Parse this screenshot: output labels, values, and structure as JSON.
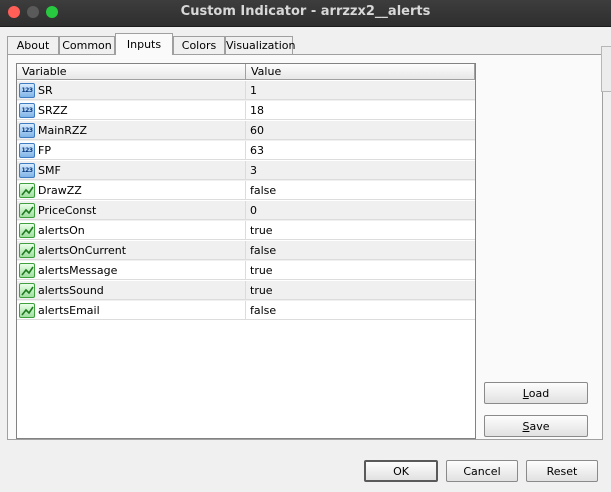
{
  "window": {
    "title": "Custom Indicator - arrzzx2__alerts"
  },
  "tabs": [
    {
      "label": "About"
    },
    {
      "label": "Common"
    },
    {
      "label": "Inputs",
      "active": true
    },
    {
      "label": "Colors"
    },
    {
      "label": "Visualization"
    }
  ],
  "grid": {
    "columns": {
      "variable": "Variable",
      "value": "Value"
    },
    "rows": [
      {
        "name": "SR",
        "value": "1",
        "kind": "number"
      },
      {
        "name": "SRZZ",
        "value": "18",
        "kind": "number"
      },
      {
        "name": "MainRZZ",
        "value": "60",
        "kind": "number"
      },
      {
        "name": "FP",
        "value": "63",
        "kind": "number"
      },
      {
        "name": "SMF",
        "value": "3",
        "kind": "number"
      },
      {
        "name": "DrawZZ",
        "value": "false",
        "kind": "bool"
      },
      {
        "name": "PriceConst",
        "value": "0",
        "kind": "bool"
      },
      {
        "name": "alertsOn",
        "value": "true",
        "kind": "bool"
      },
      {
        "name": "alertsOnCurrent",
        "value": "false",
        "kind": "bool"
      },
      {
        "name": "alertsMessage",
        "value": "true",
        "kind": "bool"
      },
      {
        "name": "alertsSound",
        "value": "true",
        "kind": "bool"
      },
      {
        "name": "alertsEmail",
        "value": "false",
        "kind": "bool"
      }
    ]
  },
  "side_buttons": {
    "load": {
      "first": "L",
      "rest": "oad"
    },
    "save": {
      "first": "S",
      "rest": "ave"
    }
  },
  "footer": {
    "ok": "OK",
    "cancel": "Cancel",
    "reset": "Reset"
  },
  "icons": {
    "number": "123",
    "bool": "bool-icon"
  }
}
